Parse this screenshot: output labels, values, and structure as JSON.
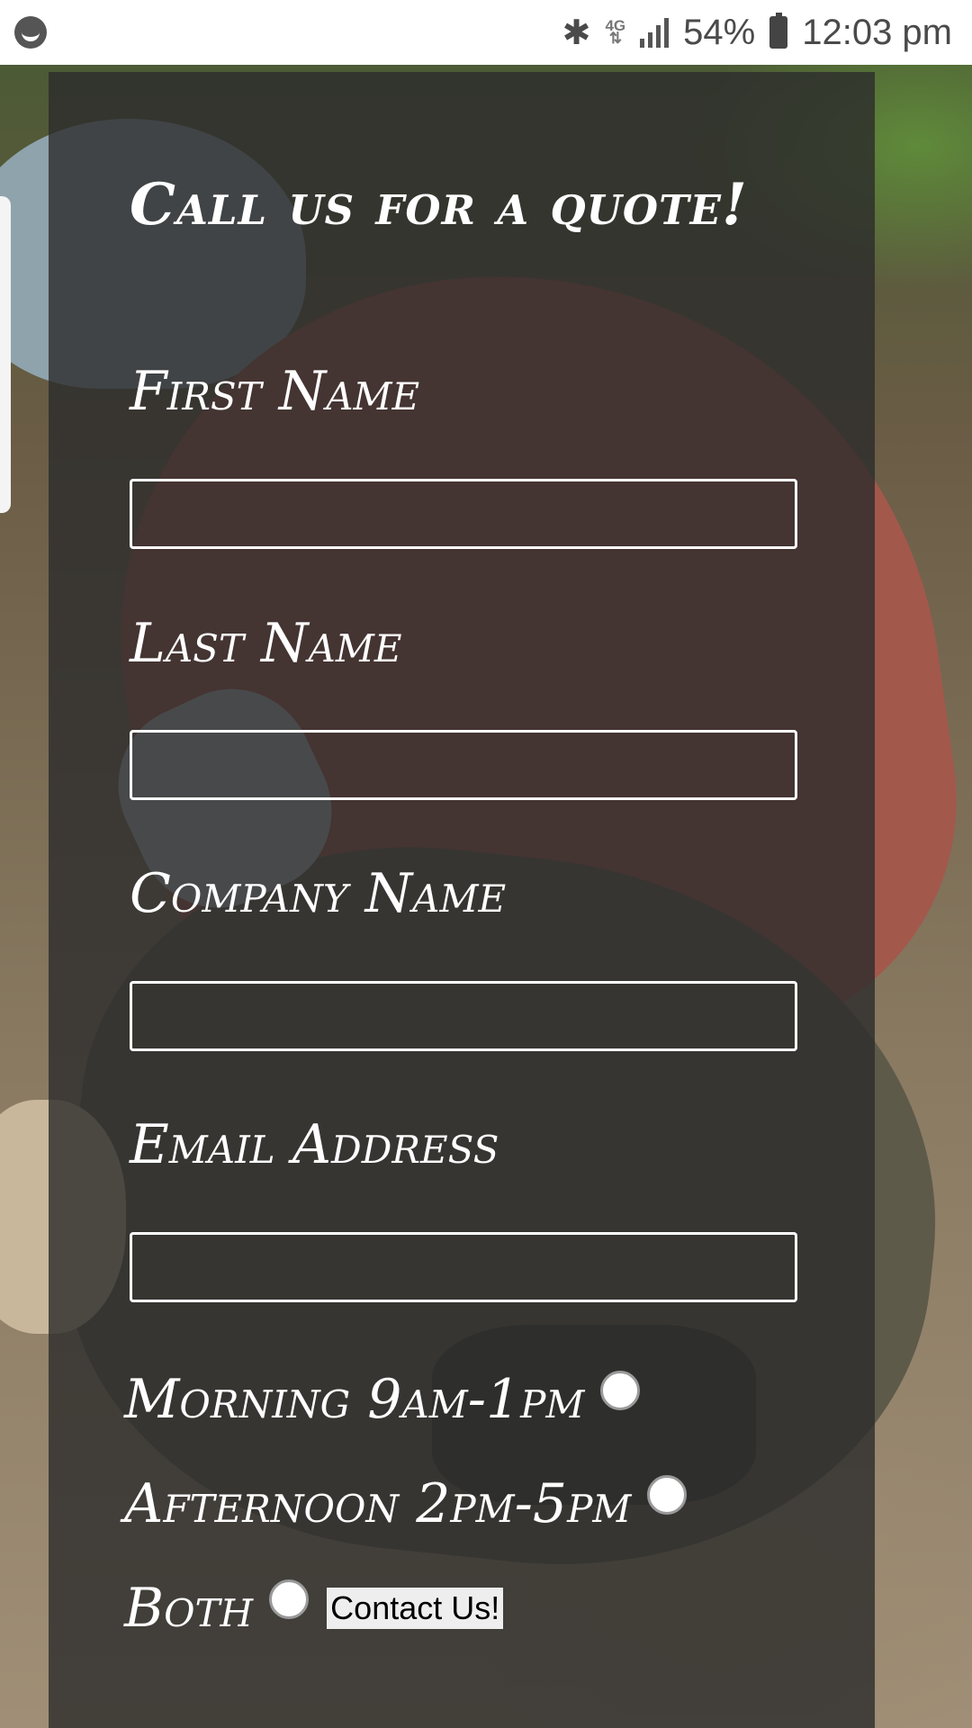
{
  "status_bar": {
    "bluetooth_icon": "bluetooth-icon",
    "network_type": "4G",
    "signal_icon": "signal-bars-icon",
    "battery_percent": "54%",
    "battery_icon": "battery-charging-icon",
    "time": "12:03 pm"
  },
  "form": {
    "title": "Call us for a quote!",
    "fields": [
      {
        "label": "First Name",
        "value": ""
      },
      {
        "label": "Last Name",
        "value": ""
      },
      {
        "label": "Company Name",
        "value": ""
      },
      {
        "label": "Email Address",
        "value": ""
      }
    ],
    "time_options": [
      {
        "label": "Morning 9am-1pm",
        "selected": false
      },
      {
        "label": "Afternoon 2pm-5pm",
        "selected": false
      },
      {
        "label": "Both",
        "selected": false
      }
    ],
    "submit_label": "Contact Us!"
  },
  "colors": {
    "panel_overlay": "#2c2c2c",
    "text": "#ffffff",
    "input_border": "#ffffff",
    "button_bg": "#eeeeee"
  }
}
